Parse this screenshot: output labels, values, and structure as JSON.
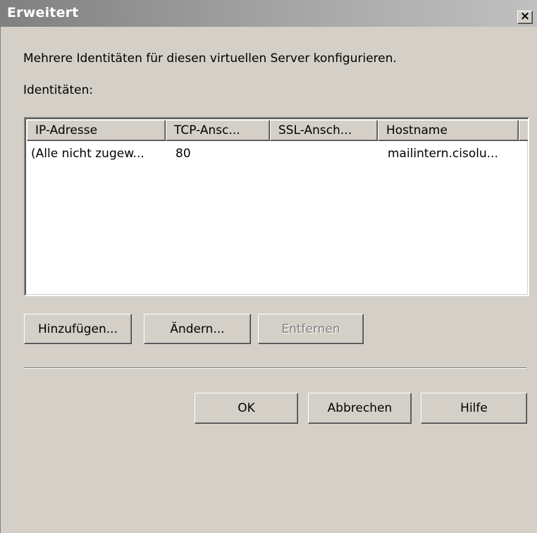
{
  "window": {
    "title": "Erweitert",
    "close_glyph": "×"
  },
  "description": "Mehrere Identitäten für diesen virtuellen Server konfigurieren.",
  "identities_label": "Identitäten:",
  "list": {
    "columns": [
      "IP-Adresse",
      "TCP-Ansc...",
      "SSL-Ansch...",
      "Hostname"
    ],
    "rows": [
      {
        "ip": "(Alle nicht zugew...",
        "tcp": "80",
        "ssl": "",
        "hostname": "mailintern.cisolu..."
      }
    ]
  },
  "buttons": {
    "add": "Hinzufügen...",
    "edit": "Ändern...",
    "remove": "Entfernen",
    "ok": "OK",
    "cancel": "Abbrechen",
    "help": "Hilfe"
  },
  "icons": {
    "close": "close-icon"
  }
}
